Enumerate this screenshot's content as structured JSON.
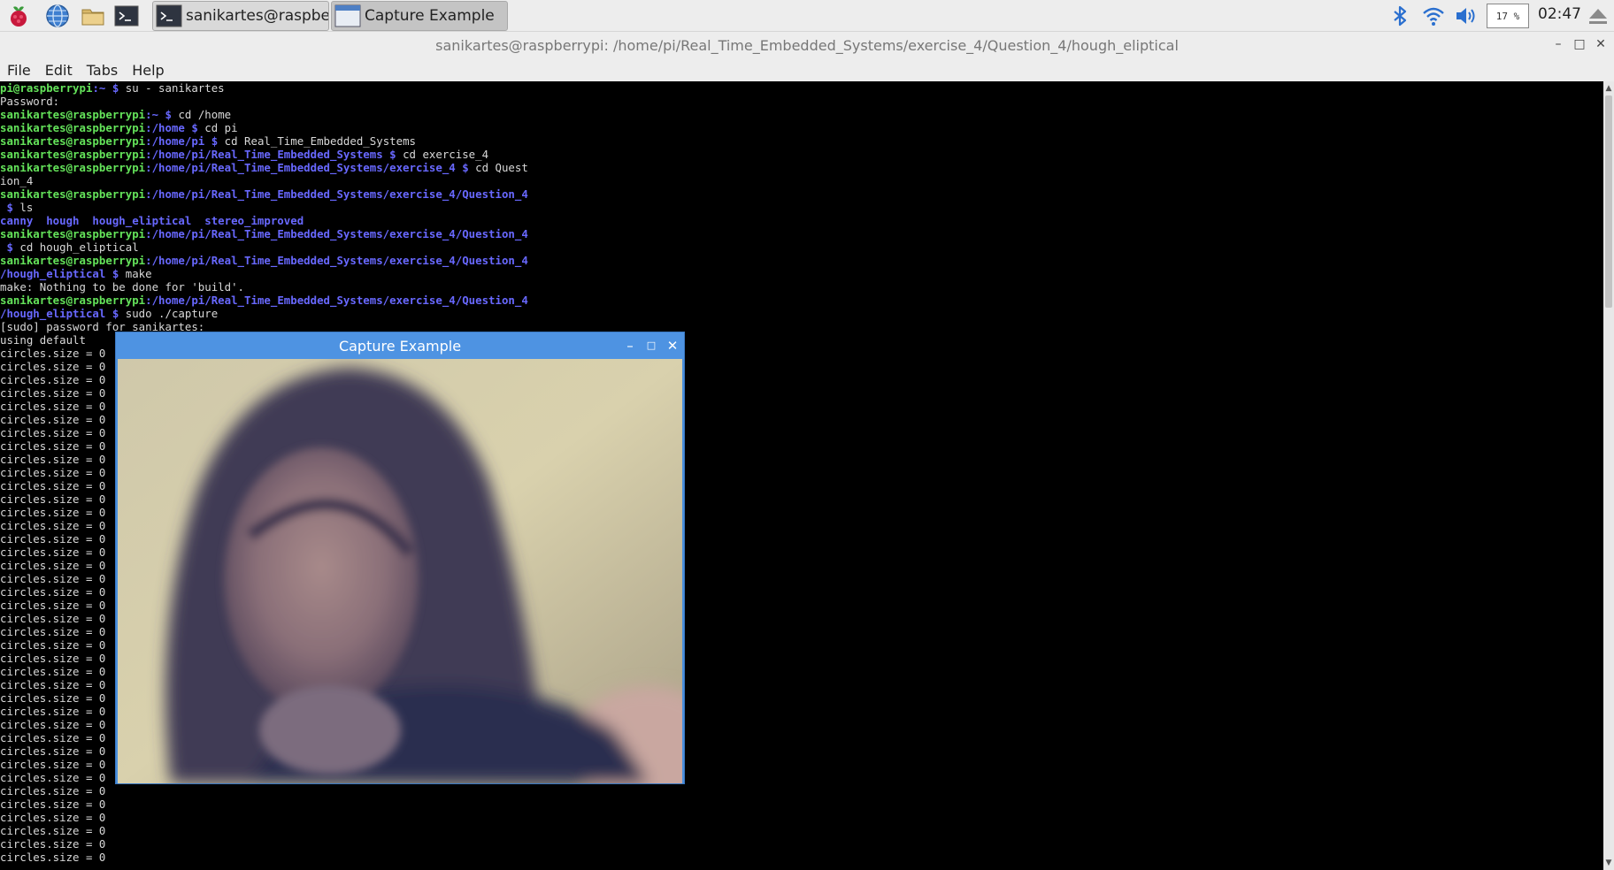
{
  "taskbar": {
    "launchers": [
      "raspberry-menu-icon",
      "web-browser-icon",
      "file-manager-icon",
      "terminal-icon"
    ],
    "tasks": [
      {
        "label": "sanikartes@raspberr...",
        "icon": "terminal-icon",
        "active": false
      },
      {
        "label": "Capture Example",
        "icon": "window-icon",
        "active": true
      }
    ],
    "tray": {
      "icons": [
        "bluetooth-icon",
        "wifi-icon",
        "volume-icon",
        "eject-icon"
      ],
      "cpu_usage": "17 %",
      "clock": "02:47"
    }
  },
  "terminal_window": {
    "title": "sanikartes@raspberrypi: /home/pi/Real_Time_Embedded_Systems/exercise_4/Question_4/hough_eliptical",
    "controls": [
      "minimize-icon",
      "maximize-icon",
      "close-icon"
    ],
    "menu": [
      "File",
      "Edit",
      "Tabs",
      "Help"
    ],
    "lines": [
      [
        {
          "t": "pi@raspberrypi",
          "c": "u"
        },
        {
          "t": ":~ $ ",
          "c": "p"
        },
        {
          "t": "su - sanikartes",
          "c": ""
        }
      ],
      [
        {
          "t": "Password:",
          "c": ""
        }
      ],
      [
        {
          "t": "sanikartes@raspberrypi",
          "c": "u"
        },
        {
          "t": ":~ $ ",
          "c": "p"
        },
        {
          "t": "cd /home",
          "c": ""
        }
      ],
      [
        {
          "t": "sanikartes@raspberrypi",
          "c": "u"
        },
        {
          "t": ":/home $ ",
          "c": "p"
        },
        {
          "t": "cd pi",
          "c": ""
        }
      ],
      [
        {
          "t": "sanikartes@raspberrypi",
          "c": "u"
        },
        {
          "t": ":/home/pi $ ",
          "c": "p"
        },
        {
          "t": "cd Real_Time_Embedded_Systems",
          "c": ""
        }
      ],
      [
        {
          "t": "sanikartes@raspberrypi",
          "c": "u"
        },
        {
          "t": ":/home/pi/Real_Time_Embedded_Systems $ ",
          "c": "p"
        },
        {
          "t": "cd exercise_4",
          "c": ""
        }
      ],
      [
        {
          "t": "sanikartes@raspberrypi",
          "c": "u"
        },
        {
          "t": ":/home/pi/Real_Time_Embedded_Systems/exercise_4 $ ",
          "c": "p"
        },
        {
          "t": "cd Quest",
          "c": ""
        }
      ],
      [
        {
          "t": "ion_4",
          "c": ""
        }
      ],
      [
        {
          "t": "sanikartes@raspberrypi",
          "c": "u"
        },
        {
          "t": ":/home/pi/Real_Time_Embedded_Systems/exercise_4/Question_4",
          "c": "p"
        }
      ],
      [
        {
          "t": " $ ",
          "c": "p"
        },
        {
          "t": "ls",
          "c": ""
        }
      ],
      [
        {
          "t": "canny  hough  hough_eliptical  stereo_improved",
          "c": "b"
        }
      ],
      [
        {
          "t": "sanikartes@raspberrypi",
          "c": "u"
        },
        {
          "t": ":/home/pi/Real_Time_Embedded_Systems/exercise_4/Question_4",
          "c": "p"
        }
      ],
      [
        {
          "t": " $ ",
          "c": "p"
        },
        {
          "t": "cd hough_eliptical",
          "c": ""
        }
      ],
      [
        {
          "t": "sanikartes@raspberrypi",
          "c": "u"
        },
        {
          "t": ":/home/pi/Real_Time_Embedded_Systems/exercise_4/Question_4",
          "c": "p"
        }
      ],
      [
        {
          "t": "/hough_eliptical $ ",
          "c": "p"
        },
        {
          "t": "make",
          "c": ""
        }
      ],
      [
        {
          "t": "make: Nothing to be done for 'build'.",
          "c": ""
        }
      ],
      [
        {
          "t": "sanikartes@raspberrypi",
          "c": "u"
        },
        {
          "t": ":/home/pi/Real_Time_Embedded_Systems/exercise_4/Question_4",
          "c": "p"
        }
      ],
      [
        {
          "t": "/hough_eliptical $ ",
          "c": "p"
        },
        {
          "t": "sudo ./capture",
          "c": ""
        }
      ],
      [
        {
          "t": "[sudo] password for sanikartes:",
          "c": ""
        }
      ],
      [
        {
          "t": "using default",
          "c": ""
        }
      ],
      [
        {
          "t": "circles.size = 0",
          "c": ""
        }
      ],
      [
        {
          "t": "circles.size = 0",
          "c": ""
        }
      ],
      [
        {
          "t": "circles.size = 0",
          "c": ""
        }
      ],
      [
        {
          "t": "circles.size = 0",
          "c": ""
        }
      ],
      [
        {
          "t": "circles.size = 0",
          "c": ""
        }
      ],
      [
        {
          "t": "circles.size = 0",
          "c": ""
        }
      ],
      [
        {
          "t": "circles.size = 0",
          "c": ""
        }
      ],
      [
        {
          "t": "circles.size = 0",
          "c": ""
        }
      ],
      [
        {
          "t": "circles.size = 0",
          "c": ""
        }
      ],
      [
        {
          "t": "circles.size = 0",
          "c": ""
        }
      ],
      [
        {
          "t": "circles.size = 0",
          "c": ""
        }
      ],
      [
        {
          "t": "circles.size = 0",
          "c": ""
        }
      ],
      [
        {
          "t": "circles.size = 0",
          "c": ""
        }
      ],
      [
        {
          "t": "circles.size = 0",
          "c": ""
        }
      ],
      [
        {
          "t": "circles.size = 0",
          "c": ""
        }
      ],
      [
        {
          "t": "circles.size = 0",
          "c": ""
        }
      ],
      [
        {
          "t": "circles.size = 0",
          "c": ""
        }
      ],
      [
        {
          "t": "circles.size = 0",
          "c": ""
        }
      ],
      [
        {
          "t": "circles.size = 0",
          "c": ""
        }
      ],
      [
        {
          "t": "circles.size = 0",
          "c": ""
        }
      ],
      [
        {
          "t": "circles.size = 0",
          "c": ""
        }
      ],
      [
        {
          "t": "circles.size = 0",
          "c": ""
        }
      ],
      [
        {
          "t": "circles.size = 0",
          "c": ""
        }
      ],
      [
        {
          "t": "circles.size = 0",
          "c": ""
        }
      ],
      [
        {
          "t": "circles.size = 0",
          "c": ""
        }
      ],
      [
        {
          "t": "circles.size = 0",
          "c": ""
        }
      ],
      [
        {
          "t": "circles.size = 0",
          "c": ""
        }
      ],
      [
        {
          "t": "circles.size = 0",
          "c": ""
        }
      ],
      [
        {
          "t": "circles.size = 0",
          "c": ""
        }
      ],
      [
        {
          "t": "circles.size = 0",
          "c": ""
        }
      ],
      [
        {
          "t": "circles.size = 0",
          "c": ""
        }
      ],
      [
        {
          "t": "circles.size = 0",
          "c": ""
        }
      ],
      [
        {
          "t": "circles.size = 0",
          "c": ""
        }
      ],
      [
        {
          "t": "circles.size = 0",
          "c": ""
        }
      ],
      [
        {
          "t": "circles.size = 0",
          "c": ""
        }
      ],
      [
        {
          "t": "circles.size = 0",
          "c": ""
        }
      ],
      [
        {
          "t": "circles.size = 0",
          "c": ""
        }
      ],
      [
        {
          "t": "circles.size = 0",
          "c": ""
        }
      ],
      [
        {
          "t": "circles.size = 0",
          "c": ""
        }
      ]
    ]
  },
  "capture_window": {
    "title": "Capture Example",
    "controls": [
      "minimize-icon",
      "maximize-icon",
      "close-icon"
    ],
    "content": "webcam-frame"
  },
  "colors": {
    "prompt_user": "#64e35a",
    "prompt_path": "#6868ff",
    "capture_titlebar": "#4e93e2",
    "panel_bg": "#ededed"
  }
}
